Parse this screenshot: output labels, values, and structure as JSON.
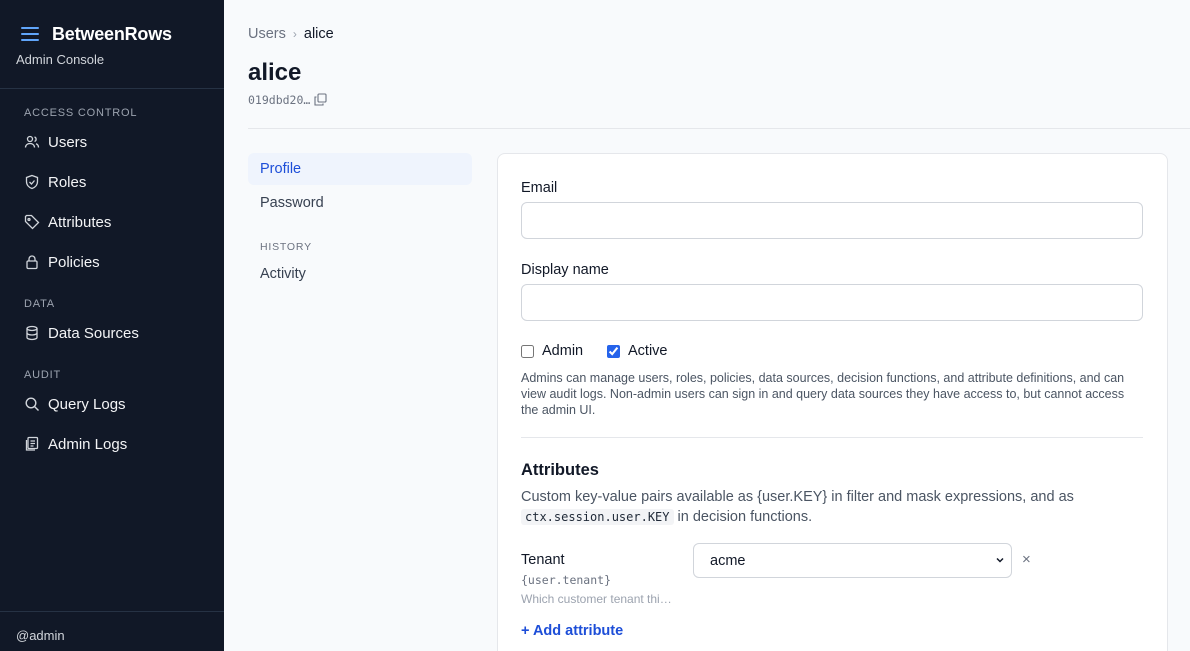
{
  "sidebar": {
    "brand": "BetweenRows",
    "subtitle": "Admin Console",
    "sections": {
      "access_control": "ACCESS CONTROL",
      "data": "DATA",
      "audit": "AUDIT"
    },
    "items": {
      "users": "Users",
      "roles": "Roles",
      "attributes": "Attributes",
      "policies": "Policies",
      "data_sources": "Data Sources",
      "query_logs": "Query Logs",
      "admin_logs": "Admin Logs"
    },
    "footer_user": "@admin"
  },
  "header": {
    "breadcrumb_parent": "Users",
    "breadcrumb_separator": "›",
    "breadcrumb_current": "alice",
    "title": "alice",
    "user_id": "019dbd20…"
  },
  "subnav": {
    "profile": "Profile",
    "password": "Password",
    "history_section": "HISTORY",
    "activity": "Activity"
  },
  "form": {
    "email_label": "Email",
    "email_value": "",
    "display_name_label": "Display name",
    "display_name_value": "",
    "admin_label": "Admin",
    "admin_checked": false,
    "active_label": "Active",
    "active_checked": true,
    "help_text": "Admins can manage users, roles, policies, data sources, decision functions, and attribute definitions, and can view audit logs. Non-admin users can sign in and query data sources they have access to, but cannot access the admin UI."
  },
  "attributes": {
    "title": "Attributes",
    "desc_part1": "Custom key-value pairs available as {user.KEY} in filter and mask expressions, and as",
    "desc_code": "ctx.session.user.KEY",
    "desc_part2": "in decision functions.",
    "rows": [
      {
        "name": "Tenant",
        "key": "{user.tenant}",
        "description": "Which customer tenant thi…",
        "value": "acme",
        "remove": "×"
      }
    ],
    "add_label": "+ Add attribute"
  },
  "colors": {
    "sidebar_bg": "#111827",
    "accent": "#1d4ed8",
    "active_nav_bg": "#eff4fd",
    "hamburger_icon": "#60a5fa"
  }
}
